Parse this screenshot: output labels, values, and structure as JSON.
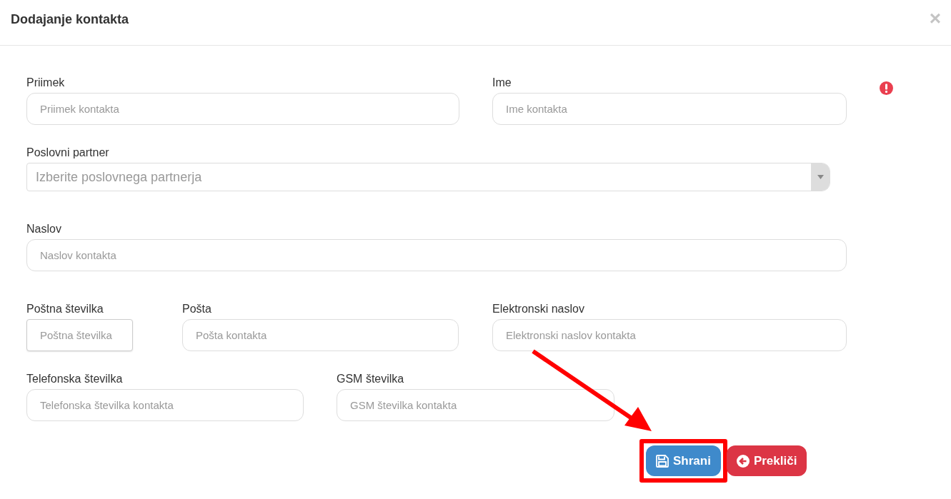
{
  "dialog": {
    "title": "Dodajanje kontakta",
    "close": "×"
  },
  "rows": [
    {
      "error": true,
      "fields": [
        {
          "kind": "text",
          "label": "Priimek",
          "placeholder": "Priimek kontakta"
        },
        {
          "kind": "text",
          "label": "Ime",
          "placeholder": "Ime kontakta"
        }
      ]
    },
    {
      "error": false,
      "fields": [
        {
          "kind": "select",
          "label": "Poslovni partner",
          "placeholder": "Izberite poslovnega partnerja"
        }
      ]
    },
    {
      "error": false,
      "fields": [
        {
          "kind": "text",
          "label": "Naslov",
          "placeholder": "Naslov kontakta"
        }
      ]
    },
    {
      "error": false,
      "fields": [
        {
          "kind": "text",
          "label": "Poštna številka",
          "placeholder": "Poštna številka"
        },
        {
          "kind": "text",
          "label": "Pošta",
          "placeholder": "Pošta kontakta"
        },
        {
          "kind": "text",
          "label": "Elektronski naslov",
          "placeholder": "Elektronski naslov kontakta"
        }
      ]
    },
    {
      "error": false,
      "fields": [
        {
          "kind": "text",
          "label": "Telefonska številka",
          "placeholder": "Telefonska številka kontakta"
        },
        {
          "kind": "text",
          "label": "GSM številka",
          "placeholder": "GSM številka kontakta"
        }
      ]
    }
  ],
  "buttons": [
    {
      "kind": "save",
      "label": "Shrani",
      "highlighted": true
    },
    {
      "kind": "cancel",
      "label": "Prekliči",
      "highlighted": false
    }
  ]
}
